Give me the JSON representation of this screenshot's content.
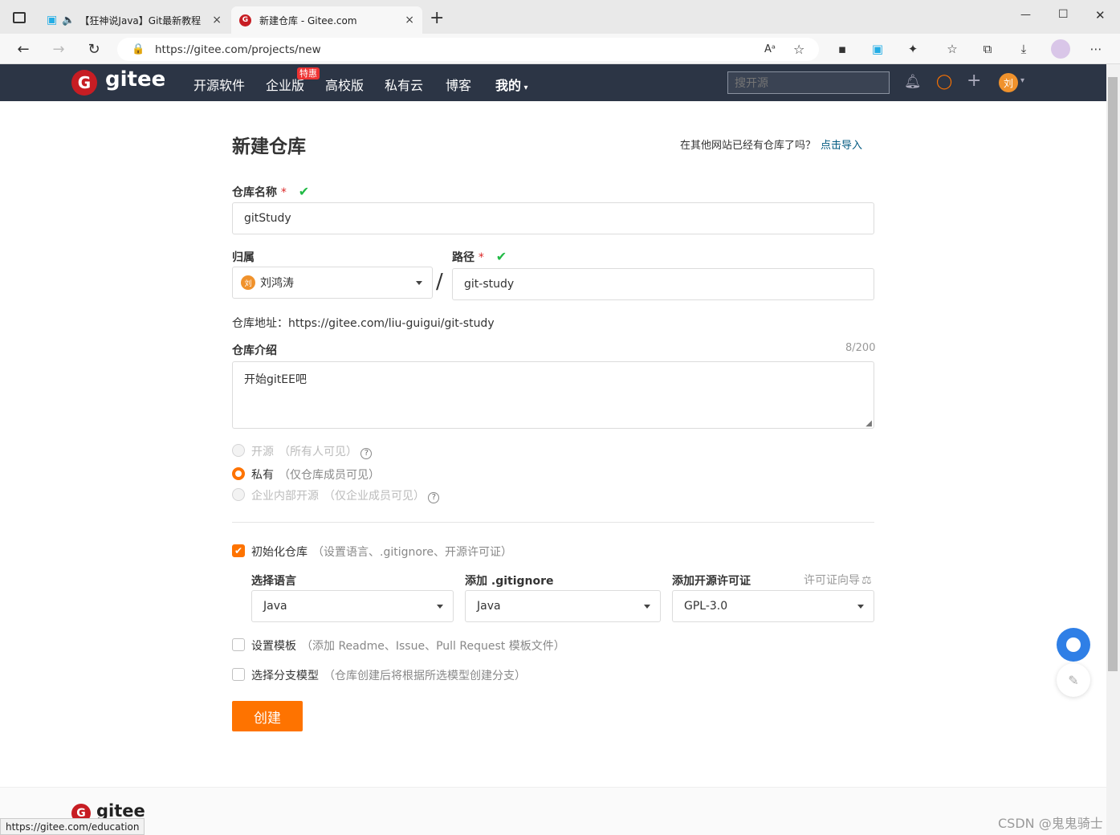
{
  "browser": {
    "tabs": [
      {
        "label": "【狂神说Java】Git最新教程",
        "close": "×"
      },
      {
        "label": "新建仓库 - Gitee.com",
        "close": "×"
      }
    ],
    "new_tab": "+",
    "url": "https://gitee.com/projects/new",
    "window_controls": {
      "minimize": "—",
      "maximize": "☐",
      "close": "✕"
    }
  },
  "navbar": {
    "logo_text": "gitee",
    "links": [
      "开源软件",
      "企业版",
      "高校版",
      "私有云",
      "博客",
      "我的"
    ],
    "promo_badge": "特惠",
    "search_placeholder": "搜开源",
    "avatar_letter": "刘"
  },
  "form": {
    "title": "新建仓库",
    "import_prompt": "在其他网站已经有仓库了吗？",
    "import_link": "点击导入",
    "repo_name_label": "仓库名称",
    "required_mark": "*",
    "repo_name_value": "gitStudy",
    "owner_label": "归属",
    "owner_value": "刘鸿涛",
    "owner_avatar": "刘",
    "separator": "/",
    "path_label": "路径",
    "path_value": "git-study",
    "address_label": "仓库地址：",
    "address_value": "https://gitee.com/liu-guigui/git-study",
    "intro_label": "仓库介绍",
    "intro_count": "8/200",
    "intro_value": "开始gitEE吧",
    "visibility": [
      {
        "label": "开源",
        "hint": "（所有人可见）",
        "selected": false,
        "disabled": true,
        "help": "?"
      },
      {
        "label": "私有",
        "hint": "（仅仓库成员可见）",
        "selected": true,
        "disabled": false
      },
      {
        "label": "企业内部开源",
        "hint": "（仅企业成员可见）",
        "selected": false,
        "disabled": true,
        "help": "?"
      }
    ],
    "init_repo_label": "初始化仓库",
    "init_repo_hint": "（设置语言、.gitignore、开源许可证）",
    "language_label": "选择语言",
    "language_value": "Java",
    "gitignore_label": "添加 .gitignore",
    "gitignore_value": "Java",
    "license_label": "添加开源许可证",
    "license_wizard": "许可证向导",
    "license_value": "GPL-3.0",
    "template_label": "设置模板",
    "template_hint": "（添加 Readme、Issue、Pull Request 模板文件）",
    "branch_label": "选择分支模型",
    "branch_hint": "（仓库创建后将根据所选模型创建分支）",
    "create_button": "创建"
  },
  "footer": {
    "logo_text": "gitee"
  },
  "status_url": "https://gitee.com/education",
  "watermark": "CSDN @鬼鬼骑士"
}
